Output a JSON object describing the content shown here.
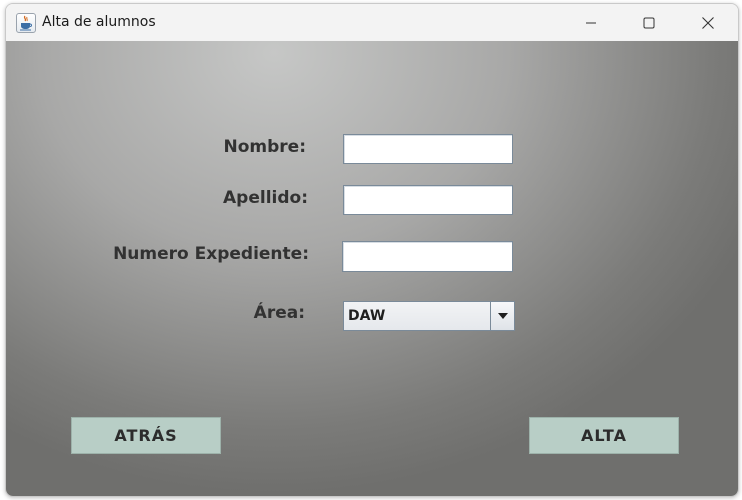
{
  "window": {
    "title": "Alta de alumnos",
    "icon": "java-cup-icon"
  },
  "title_controls": {
    "minimize": "minimize-icon",
    "maximize": "maximize-icon",
    "close": "close-icon"
  },
  "form": {
    "nombre_label": "Nombre:",
    "nombre_value": "",
    "apellido_label": "Apellido:",
    "apellido_value": "",
    "expediente_label": "Numero Expediente:",
    "expediente_value": "",
    "area_label": "Área:",
    "area_selected": "DAW"
  },
  "buttons": {
    "back_label": "ATRÁS",
    "submit_label": "ALTA"
  },
  "colors": {
    "button_bg": "#b8cec6",
    "panel_center": "#c6c7c6",
    "panel_edge": "#6f6f6d"
  }
}
